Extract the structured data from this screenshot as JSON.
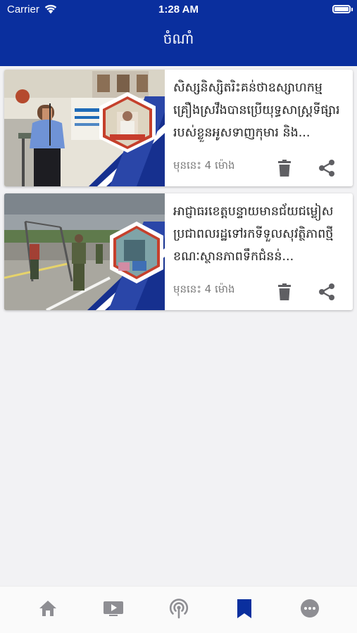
{
  "status_bar": {
    "carrier": "Carrier",
    "time": "1:28 AM"
  },
  "header": {
    "title": "ចំណាំ"
  },
  "articles": [
    {
      "title": "សិស្សនិស្សិតរិះគន់ថាឧស្សាហកម្មគ្រឿងស្រវឹងបានប្រើយុទ្ធសាស្ត្រទីផ្សាររបស់ខ្លួនអូសទាញកុមារ និង...",
      "time": "មុននេះ 4 ម៉ោង",
      "thumbnail_icon": "news-photo-speaker-thumbnail"
    },
    {
      "title": "អាជ្ញាធរខេត្តបន្ទាយមានជ័យជម្លៀសប្រជាពលរដ្ឋទៅរកទីទួលសុវត្ថិភាពថ្មី ខណៈស្ថានភាពទឹកជំនន់...",
      "time": "មុននេះ 4 ម៉ោង",
      "thumbnail_icon": "news-photo-road-thumbnail"
    }
  ],
  "tabbar": {
    "items": [
      {
        "name": "home",
        "icon": "home-icon",
        "active": false
      },
      {
        "name": "video",
        "icon": "video-icon",
        "active": false
      },
      {
        "name": "radio",
        "icon": "radio-broadcast-icon",
        "active": false
      },
      {
        "name": "bookmark",
        "icon": "bookmark-icon",
        "active": true
      },
      {
        "name": "more",
        "icon": "more-icon",
        "active": false
      }
    ]
  },
  "colors": {
    "header_bg": "#0a2f9e",
    "tab_active": "#0a2f9e",
    "tab_inactive": "#8e8e93",
    "action_icon": "#5f5f63"
  }
}
